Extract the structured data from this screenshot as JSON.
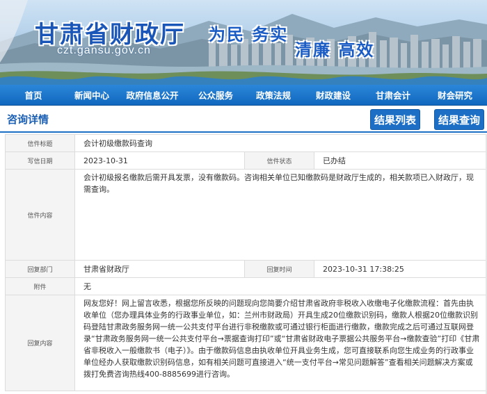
{
  "banner": {
    "site_title": "甘肃省财政厅",
    "site_domain": "czt.gansu.gov.cn",
    "slogan_1": "为民  务实",
    "slogan_2": "清廉  高效"
  },
  "nav": {
    "items": [
      "首页",
      "新闻中心",
      "政府信息公开",
      "公众服务",
      "政策法规",
      "财政建设",
      "甘肃会计",
      "财会研究"
    ]
  },
  "section": {
    "title": "咨询详情",
    "list_button": "结果列表",
    "query_button": "结果查询"
  },
  "detail": {
    "title_label": "信件标题",
    "title_value": "会计初级缴款码查询",
    "date_label": "写信日期",
    "date_value": "2023-10-31",
    "status_label": "信件状态",
    "status_value": "已办结",
    "content_label": "信件内容",
    "content_value": "会计初级报名缴款后需开具发票，没有缴款码。咨询相关单位已知缴款码是财政厅生成的，相关款项已入财政厅，现需查询。",
    "dept_label": "回复部门",
    "dept_value": "甘肃省财政厅",
    "reply_time_label": "回复时间",
    "reply_time_value": "2023-10-31 17:38:25",
    "attachment_label": "附件",
    "attachment_value": "无",
    "reply_label": "回复内容",
    "reply_value": "网友您好！网上留言收悉，根据您所反映的问题现向您简要介绍甘肃省政府非税收入收缴电子化缴款流程：首先由执收单位（您办理具体业务的行政事业单位，如：兰州市财政局）开具生成20位缴款识别码，缴款人根据20位缴款识别码登陆甘肃政务服务网一统一公共支付平台进行非税缴款或可通过银行柜面进行缴款，缴款完成之后可通过互联网登录“甘肃政务服务网一统一公共支付平台→票据查询打印”或“甘肃省财政电子票据公共服务平台→缴款查验”打印《甘肃省非税收入一般缴款书（电子）》。由于缴款码信息由执收单位开具业务生成，您可直接联系向您生成业务的行政事业单位经办人获取缴款识别码信息，如有相关问题可直接进入“统一支付平台→常见问题解答”查看相关问题解决方案或拨打免费咨询热线400-8885699进行咨询。"
  },
  "colors": {
    "accent": "#1c6fc5",
    "nav_bg": "#1168bf",
    "label_bg": "#f4f4f4"
  }
}
